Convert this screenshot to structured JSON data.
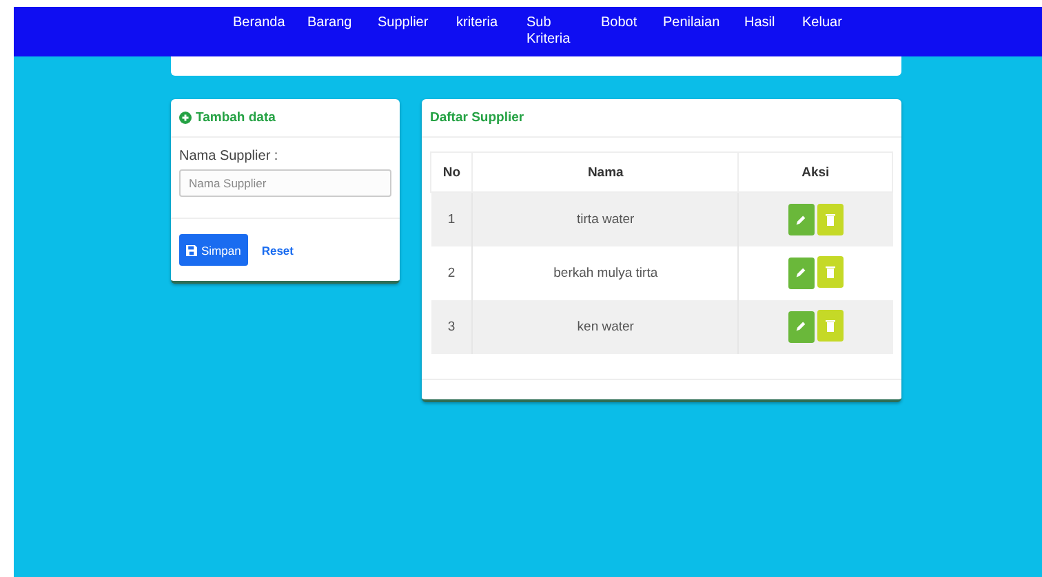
{
  "nav": {
    "items": [
      {
        "label": "Beranda"
      },
      {
        "label": "Barang"
      },
      {
        "label": "Supplier"
      },
      {
        "label": "kriteria"
      },
      {
        "label": "Sub Kriteria"
      },
      {
        "label": "Bobot"
      },
      {
        "label": "Penilaian"
      },
      {
        "label": "Hasil"
      },
      {
        "label": "Keluar"
      }
    ]
  },
  "form": {
    "title": "Tambah data",
    "label": "Nama Supplier :",
    "placeholder": "Nama Supplier",
    "save": "Simpan",
    "reset": "Reset"
  },
  "table": {
    "title": "Daftar Supplier",
    "columns": [
      "No",
      "Nama",
      "Aksi"
    ],
    "rows": [
      {
        "no": "1",
        "nama": "tirta water"
      },
      {
        "no": "2",
        "nama": "berkah mulya tirta"
      },
      {
        "no": "3",
        "nama": "ken water"
      }
    ]
  }
}
